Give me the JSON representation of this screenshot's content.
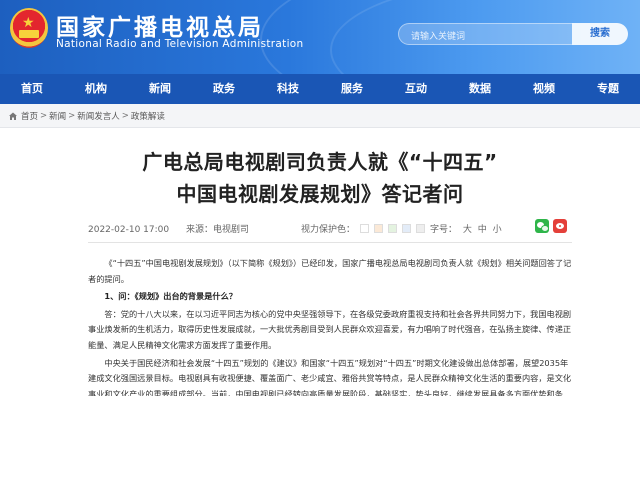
{
  "header": {
    "site_name_cn": "国家广播电视总局",
    "site_name_en": "National Radio and Television Administration",
    "search_placeholder": "请输入关键词",
    "search_button": "搜索"
  },
  "nav": [
    "首页",
    "机构",
    "新闻",
    "政务",
    "科技",
    "服务",
    "互动",
    "数据",
    "视频",
    "专题"
  ],
  "breadcrumb": [
    "首页",
    "新闻",
    "新闻发言人",
    "政策解读"
  ],
  "article": {
    "title_line1": "广电总局电视剧司负责人就《“十四五”",
    "title_line2": "中国电视剧发展规划》答记者问",
    "date": "2022-02-10 17:00",
    "source": "来源：电视剧司",
    "vision_label": "视力保护色：",
    "swatches": [
      "#ffffff",
      "#fbe9d7",
      "#e4f3e0",
      "#e3ecf8",
      "#eeeeee"
    ],
    "fontsize_label": "字号：",
    "fontsize_options": [
      "大",
      "中",
      "小"
    ],
    "paragraphs": [
      "《“十四五”中国电视剧发展规划》（以下简称《规划》）已经印发，国家广播电视总局电视剧司负责人就《规划》相关问题回答了记者的提问。",
      "1、问：《规划》出台的背景是什么？",
      "答：党的十八大以来，在以习近平同志为核心的党中央坚强领导下，在各级党委政府重视支持和社会各界共同努力下，我国电视剧事业焕发新的生机活力，取得历史性发展成就，一大批优秀剧目受到人民群众欢迎喜爱，有力唱响了时代强音，在弘扬主旋律、传递正能量、满足人民精神文化需求方面发挥了重要作用。",
      "中央关于国民经济和社会发展“十四五”规划的《建议》和国家“十四五”规划对“十四五”时期文化建设做出总体部署，展望2035年建成文化强国远景目标。电视剧具有收视便捷、覆盖面广、老少咸宜、雅俗共赏等特点，是人民群众精神文化生活的重要内容，是文化事业和文化产业的重要组成部分。当前，中国电视剧已经转向高质量发展阶段，基础坚实，势头良好，继续发展具备多方面优势和条件。“十四五”时期仍然是中国电视剧发展的重要战略机遇期，但机遇和挑战都有新的发展变化，发展不平衡不充分问题仍然存在，改革创新任务艰巨。面向2035年建成文化强国远景目标，面向第二个百年奋斗目标，要完整、准确、全面贯彻新发展理念，在解决突出问题、共性问题、关键问题中实现战略突破，在把握战略全局中推进精品创作、市场体系建设、行风建设、队伍建设、法规制度建设等各项工作，持续繁荣电视剧创作生产，提高电视剧产业质量效益和核心竞争力。"
    ]
  }
}
